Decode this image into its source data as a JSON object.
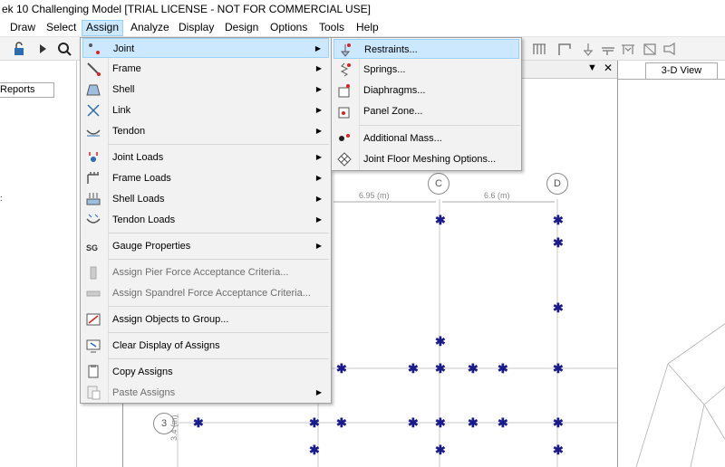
{
  "window": {
    "title": "ek 10 Challenging Model  [TRIAL LICENSE - NOT FOR COMMERCIAL USE]"
  },
  "menubar": {
    "items": [
      {
        "label": "Draw"
      },
      {
        "label": "Select"
      },
      {
        "label": "Assign"
      },
      {
        "label": "Analyze"
      },
      {
        "label": "Display"
      },
      {
        "label": "Design"
      },
      {
        "label": "Options"
      },
      {
        "label": "Tools"
      },
      {
        "label": "Help"
      }
    ],
    "active": "Assign"
  },
  "left_panel": {
    "reports_tab": "Reports"
  },
  "plan_view": {
    "grid_bubbles": [
      "C",
      "D",
      "3"
    ],
    "dimensions": [
      "6.95 (m)",
      "6.6 (m)",
      "3.4 (m)"
    ]
  },
  "view3d": {
    "tab_label": "3-D View"
  },
  "assign_menu": {
    "items": [
      {
        "label": "Joint",
        "icon": "joint-icon",
        "submenu": true,
        "highlighted": true
      },
      {
        "label": "Frame",
        "icon": "frame-icon",
        "submenu": true
      },
      {
        "label": "Shell",
        "icon": "shell-icon",
        "submenu": true
      },
      {
        "label": "Link",
        "icon": "link-icon",
        "submenu": true
      },
      {
        "label": "Tendon",
        "icon": "tendon-icon",
        "submenu": true
      },
      {
        "label": "Joint Loads",
        "icon": "joint-loads-icon",
        "submenu": true
      },
      {
        "label": "Frame Loads",
        "icon": "frame-loads-icon",
        "submenu": true
      },
      {
        "label": "Shell Loads",
        "icon": "shell-loads-icon",
        "submenu": true
      },
      {
        "label": "Tendon Loads",
        "icon": "tendon-loads-icon",
        "submenu": true
      },
      {
        "label": "Gauge Properties",
        "icon": "gauge-icon",
        "submenu": true
      },
      {
        "label": "Assign Pier Force Acceptance Criteria...",
        "icon": "pier-icon",
        "disabled": true
      },
      {
        "label": "Assign Spandrel Force Acceptance Criteria...",
        "icon": "spandrel-icon",
        "disabled": true
      },
      {
        "label": "Assign Objects to Group...",
        "icon": "group-icon"
      },
      {
        "label": "Clear Display of Assigns",
        "icon": "clear-display-icon"
      },
      {
        "label": "Copy Assigns",
        "icon": "copy-icon"
      },
      {
        "label": "Paste Assigns",
        "icon": "paste-icon",
        "submenu": true,
        "disabled": true
      }
    ]
  },
  "joint_submenu": {
    "items": [
      {
        "label": "Restraints...",
        "icon": "restraints-icon",
        "highlighted": true
      },
      {
        "label": "Springs...",
        "icon": "springs-icon"
      },
      {
        "label": "Diaphragms...",
        "icon": "diaphragms-icon"
      },
      {
        "label": "Panel Zone...",
        "icon": "panel-zone-icon"
      },
      {
        "label": "Additional Mass...",
        "icon": "additional-mass-icon"
      },
      {
        "label": "Joint Floor Meshing Options...",
        "icon": "meshing-icon"
      }
    ]
  },
  "colors": {
    "highlight": "#cce8ff",
    "highlight_border": "#99d1ff",
    "menu_bg": "#f2f2f2",
    "joint_marker": "#1a1a8c"
  }
}
